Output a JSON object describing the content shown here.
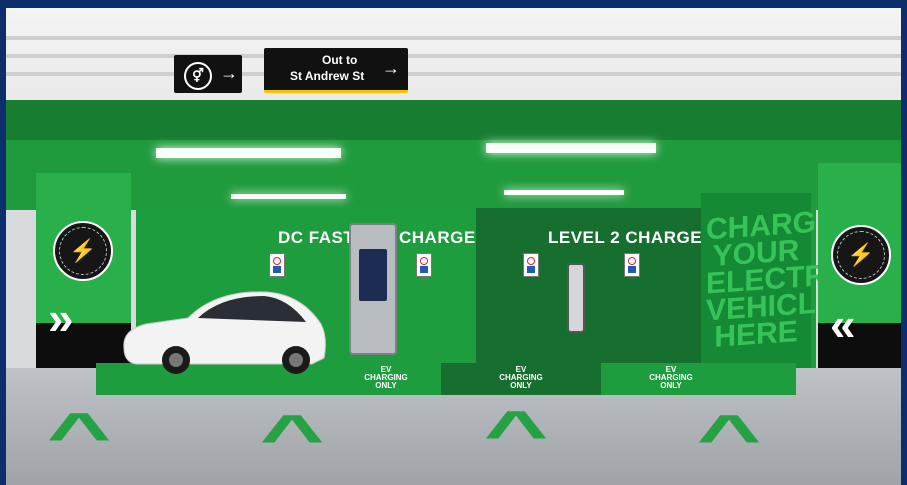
{
  "signs": {
    "toilets_arrow": "→",
    "exit_line1": "Out to",
    "exit_line2": "St Andrew St",
    "exit_arrow": "→"
  },
  "badge": {
    "ring_text": "EV CHARGE STATION",
    "icon": "ev-charge-icon"
  },
  "headings": {
    "dc_fast": "DC FAST",
    "charge": "CHARGE",
    "level2": "LEVEL 2 CHARGE"
  },
  "wall_slogan": [
    "CHARGE",
    "YOUR",
    "ELECTRIC",
    "VEHICLE",
    "HERE"
  ],
  "floor_bays": [
    {
      "line1": "EV",
      "line2": "CHARGING",
      "line3": "ONLY"
    },
    {
      "line1": "EV",
      "line2": "CHARGING",
      "line3": "ONLY"
    },
    {
      "line1": "EV",
      "line2": "CHARGING",
      "line3": "ONLY"
    }
  ],
  "colors": {
    "accent_green": "#1f9b3d",
    "dark_green": "#166f2f",
    "floor_arrow": "#26a244"
  }
}
